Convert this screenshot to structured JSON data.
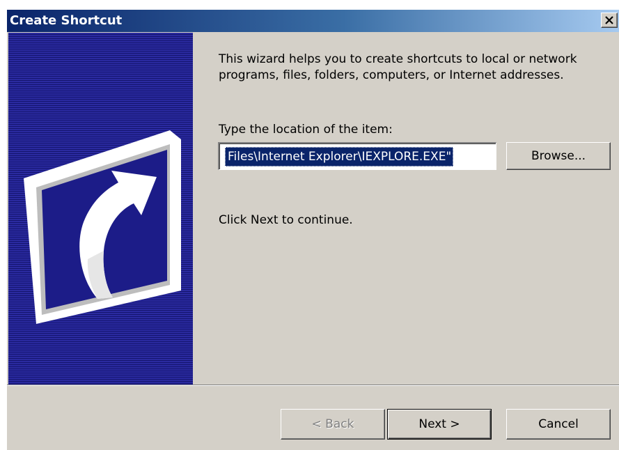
{
  "window": {
    "title": "Create Shortcut"
  },
  "content": {
    "intro": "This wizard helps you to create shortcuts to local or network programs, files, folders, computers, or Internet addresses.",
    "location_label": "Type the location of the item:",
    "location_value": "Files\\Internet Explorer\\IEXPLORE.EXE\"",
    "continue_hint": "Click Next to continue."
  },
  "buttons": {
    "browse": "Browse...",
    "back": "< Back",
    "next": "Next >",
    "cancel": "Cancel"
  },
  "icons": {
    "close": "close-icon",
    "banner": "shortcut-arrow-icon"
  },
  "state": {
    "back_enabled": false,
    "default_button": "next"
  },
  "colors": {
    "title_bar_start": "#0a246a",
    "title_bar_end": "#a6caf0",
    "dialog_face": "#d4d0c8",
    "banner_blue": "#1c1c88",
    "selection": "#0a246a"
  }
}
